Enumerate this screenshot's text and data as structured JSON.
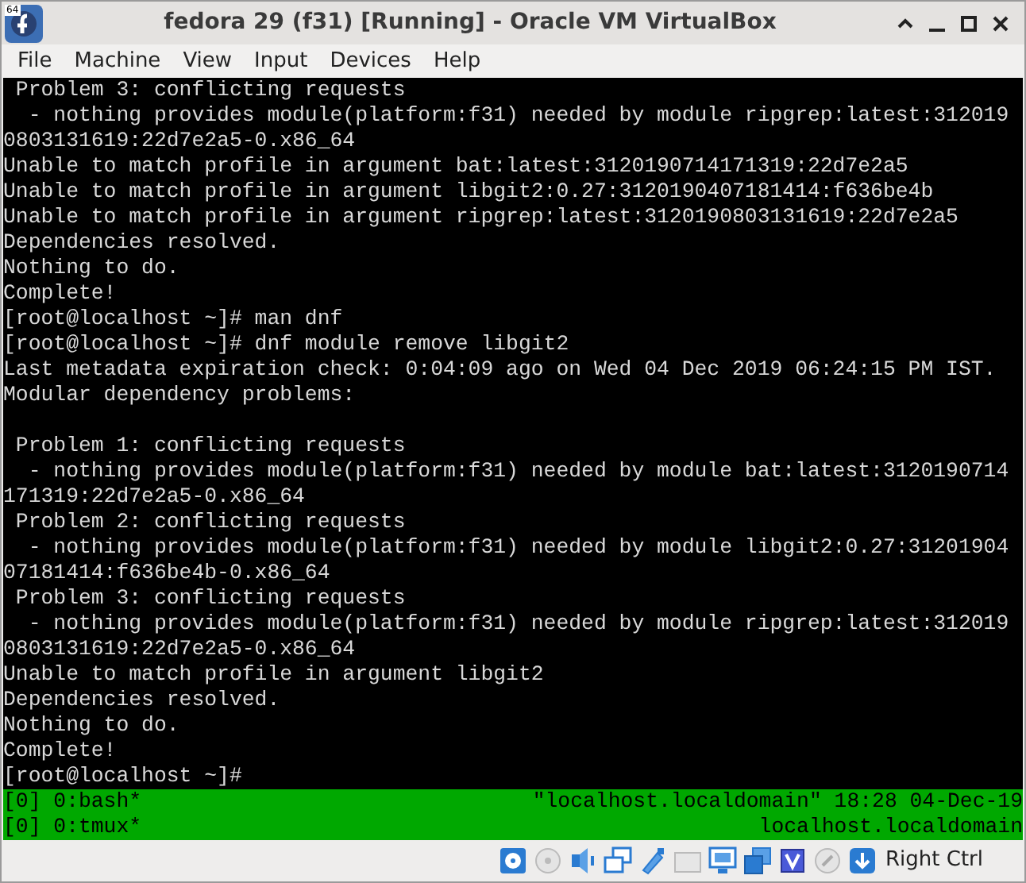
{
  "window": {
    "title": "fedora 29 (f31) [Running] - Oracle VM VirtualBox",
    "logo_badge": "64"
  },
  "menu": [
    "File",
    "Machine",
    "View",
    "Input",
    "Devices",
    "Help"
  ],
  "terminal": {
    "lines": [
      {
        "kind": "text",
        "text": " Problem 3: conflicting requests"
      },
      {
        "kind": "text",
        "text": "  - nothing provides module(platform:f31) needed by module ripgrep:latest:312019"
      },
      {
        "kind": "text",
        "text": "0803131619:22d7e2a5-0.x86_64"
      },
      {
        "kind": "text",
        "text": "Unable to match profile in argument bat:latest:3120190714171319:22d7e2a5"
      },
      {
        "kind": "text",
        "text": "Unable to match profile in argument libgit2:0.27:3120190407181414:f636be4b"
      },
      {
        "kind": "text",
        "text": "Unable to match profile in argument ripgrep:latest:3120190803131619:22d7e2a5"
      },
      {
        "kind": "text",
        "text": "Dependencies resolved."
      },
      {
        "kind": "text",
        "text": "Nothing to do."
      },
      {
        "kind": "text",
        "text": "Complete!"
      },
      {
        "kind": "text",
        "text": "[root@localhost ~]# man dnf"
      },
      {
        "kind": "text",
        "text": "[root@localhost ~]# dnf module remove libgit2"
      },
      {
        "kind": "text",
        "text": "Last metadata expiration check: 0:04:09 ago on Wed 04 Dec 2019 06:24:15 PM IST."
      },
      {
        "kind": "text",
        "text": "Modular dependency problems:"
      },
      {
        "kind": "blank"
      },
      {
        "kind": "text",
        "text": " Problem 1: conflicting requests"
      },
      {
        "kind": "text",
        "text": "  - nothing provides module(platform:f31) needed by module bat:latest:3120190714"
      },
      {
        "kind": "text",
        "text": "171319:22d7e2a5-0.x86_64"
      },
      {
        "kind": "text",
        "text": " Problem 2: conflicting requests"
      },
      {
        "kind": "text",
        "text": "  - nothing provides module(platform:f31) needed by module libgit2:0.27:31201904"
      },
      {
        "kind": "text",
        "text": "07181414:f636be4b-0.x86_64"
      },
      {
        "kind": "text",
        "text": " Problem 3: conflicting requests"
      },
      {
        "kind": "text",
        "text": "  - nothing provides module(platform:f31) needed by module ripgrep:latest:312019"
      },
      {
        "kind": "text",
        "text": "0803131619:22d7e2a5-0.x86_64"
      },
      {
        "kind": "text",
        "text": "Unable to match profile in argument libgit2"
      },
      {
        "kind": "text",
        "text": "Dependencies resolved."
      },
      {
        "kind": "text",
        "text": "Nothing to do."
      },
      {
        "kind": "text",
        "text": "Complete!"
      },
      {
        "kind": "text",
        "text": "[root@localhost ~]#"
      }
    ],
    "status_rows": [
      {
        "left": "[0] 0:bash*",
        "right": "\"localhost.localdomain\" 18:28 04-Dec-19"
      },
      {
        "left": "[0] 0:tmux*",
        "right": "localhost.localdomain"
      }
    ]
  },
  "host_key": "Right Ctrl"
}
